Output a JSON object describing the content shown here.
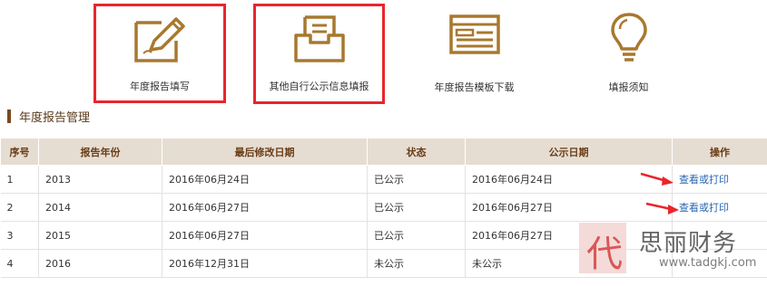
{
  "toolbar": {
    "fill_report": "年度报告填写",
    "other_info": "其他自行公示信息填报",
    "template_download": "年度报告模板下载",
    "filing_guide": "填报须知"
  },
  "section": {
    "title": "年度报告管理"
  },
  "table": {
    "headers": [
      "序号",
      "报告年份",
      "最后修改日期",
      "状态",
      "公示日期",
      "操作"
    ],
    "rows": [
      {
        "index": "1",
        "year": "2013",
        "modified": "2016年06月24日",
        "status": "已公示",
        "publish_date": "2016年06月24日",
        "action": "查看或打印"
      },
      {
        "index": "2",
        "year": "2014",
        "modified": "2016年06月27日",
        "status": "已公示",
        "publish_date": "2016年06月27日",
        "action": "查看或打印"
      },
      {
        "index": "3",
        "year": "2015",
        "modified": "2016年06月27日",
        "status": "已公示",
        "publish_date": "2016年06月27日",
        "action": ""
      },
      {
        "index": "4",
        "year": "2016",
        "modified": "2016年12月31日",
        "status": "未公示",
        "publish_date": "未公示",
        "action": ""
      }
    ]
  },
  "watermark": {
    "stamp_char": "代",
    "name": "思丽财务",
    "url": "www.tadgkj.com"
  },
  "colors": {
    "icon_gold": "#a8782f",
    "highlight_red": "#e8262b",
    "header_bg": "#e6ddd2",
    "link_blue": "#2a66b0"
  },
  "icons": [
    "pencil-form-icon",
    "inbox-tray-icon",
    "template-window-icon",
    "lightbulb-icon"
  ]
}
